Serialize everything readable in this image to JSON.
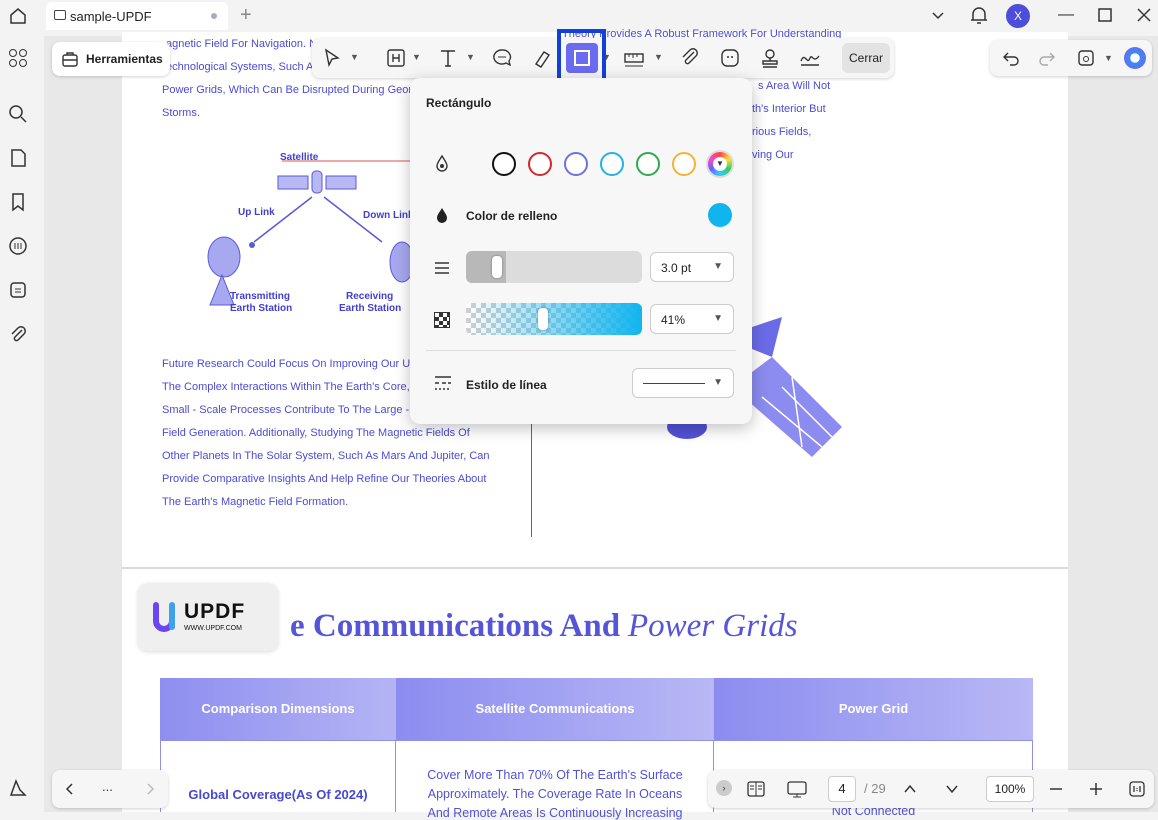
{
  "tab": {
    "title": "sample-UPDF"
  },
  "user": {
    "initial": "X"
  },
  "toolbar": {
    "herramientas": "Herramientas",
    "cerrar": "Cerrar"
  },
  "popup": {
    "title": "Rectángulo",
    "fill_label": "Color de relleno",
    "fill_color": "#10b5f0",
    "stroke_colors": [
      "#111111",
      "#d9262c",
      "#6c70e0",
      "#22b1e8",
      "#2fa84f",
      "#f5b335"
    ],
    "thickness": "3.0 pt",
    "opacity": "41%",
    "opacity_level": 0.41,
    "line_style_label": "Estilo de línea"
  },
  "doc": {
    "top_lines_left": [
      "agnetic Field For Navigation. N",
      "echnological Systems, Such A",
      "Power Grids, Which Can Be Disrupted During Geom",
      "Storms."
    ],
    "top_line_right": "Theory Provides A Robust Framework For Understanding",
    "right_lines": [
      "s Area Will Not",
      "th's Interior But",
      "rious Fields,",
      "ving Our"
    ],
    "diagram": {
      "satellite": "Satellite",
      "uplink": "Up Link",
      "downlink": "Down Link",
      "transmitting": "Transmitting",
      "transmitting2": "Earth Station",
      "receiving": "Receiving",
      "receiving2": "Earth Station"
    },
    "para": [
      "Future Research Could Focus On Improving Our Un",
      "The Complex Interactions Within The Earth's Core, E",
      "Small - Scale Processes Contribute To The Large - S",
      "Field Generation. Additionally, Studying The Magnetic Fields Of",
      "Other Planets In The Solar System, Such As Mars And Jupiter, Can",
      "Provide Comparative Insights And Help Refine Our Theories About",
      "The Earth's Magnetic Field Formation."
    ],
    "heading_bold": "e Communications And",
    "heading_italic": "Power Grids",
    "logo_text": "UPDF",
    "logo_url": "WWW.UPDF.COM",
    "table": {
      "headers": [
        "Comparison Dimensions",
        "Satellite Communications",
        "Power Grid"
      ],
      "row1_dim": "Global Coverage(As Of 2024)",
      "row1_sat": [
        "Cover More Than 70% Of The Earth's Surface",
        "Approximately. The Coverage Rate In Oceans",
        "And Remote Areas Is Continuously Increasing"
      ],
      "row1_grid": "Not Connected"
    }
  },
  "pagination": {
    "current": "4",
    "total": "/ 29",
    "zoom": "100%",
    "more": "..."
  }
}
